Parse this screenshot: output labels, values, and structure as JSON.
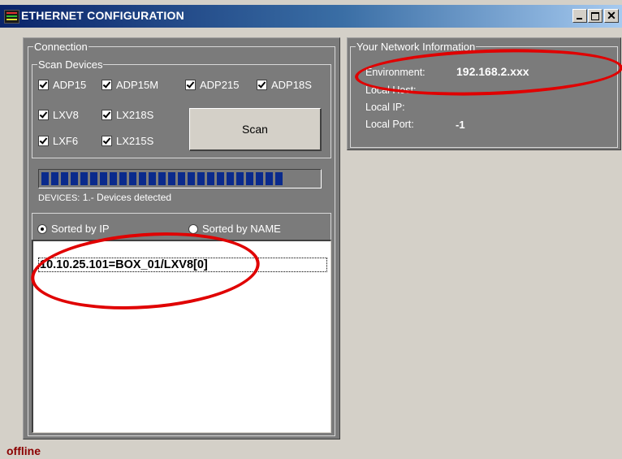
{
  "window": {
    "title": "ETHERNET CONFIGURATION",
    "buttons": {
      "minimize": "_",
      "maximize": "□",
      "close": "✕"
    }
  },
  "connection": {
    "legend": "Connection",
    "scan_devices": {
      "legend": "Scan Devices",
      "checkboxes": [
        {
          "label": "ADP15",
          "checked": true
        },
        {
          "label": "ADP15M",
          "checked": true
        },
        {
          "label": "ADP215",
          "checked": true
        },
        {
          "label": "ADP18S",
          "checked": true
        },
        {
          "label": "LXV8",
          "checked": true
        },
        {
          "label": "LX218S",
          "checked": true
        },
        {
          "label": "LXF6",
          "checked": true
        },
        {
          "label": "LX215S",
          "checked": true
        }
      ],
      "scan_button": "Scan"
    },
    "progress": {
      "segments": 25,
      "fill": 1.0
    },
    "devices_label": "DEVICES:",
    "devices_text": "1.- Devices detected",
    "sort": {
      "by_ip": "Sorted by IP",
      "by_name": "Sorted by NAME",
      "selected": "by_ip"
    },
    "devices_list": [
      "10.10.25.101=BOX_01/LXV8[0]"
    ]
  },
  "network_info": {
    "legend": "Your Network Information",
    "rows": [
      {
        "label": "Environment:",
        "value": "192.168.2.xxx"
      },
      {
        "label": "Local Host:",
        "value": ""
      },
      {
        "label": "Local IP:",
        "value": ""
      },
      {
        "label": "Local Port:",
        "value": "-1"
      }
    ]
  },
  "status": "offline",
  "colors": {
    "panel": "#7b7b7b",
    "window": "#d4d0c8",
    "progress": "#0a2a8c",
    "highlight": "#e00000",
    "status": "#8b0000"
  }
}
